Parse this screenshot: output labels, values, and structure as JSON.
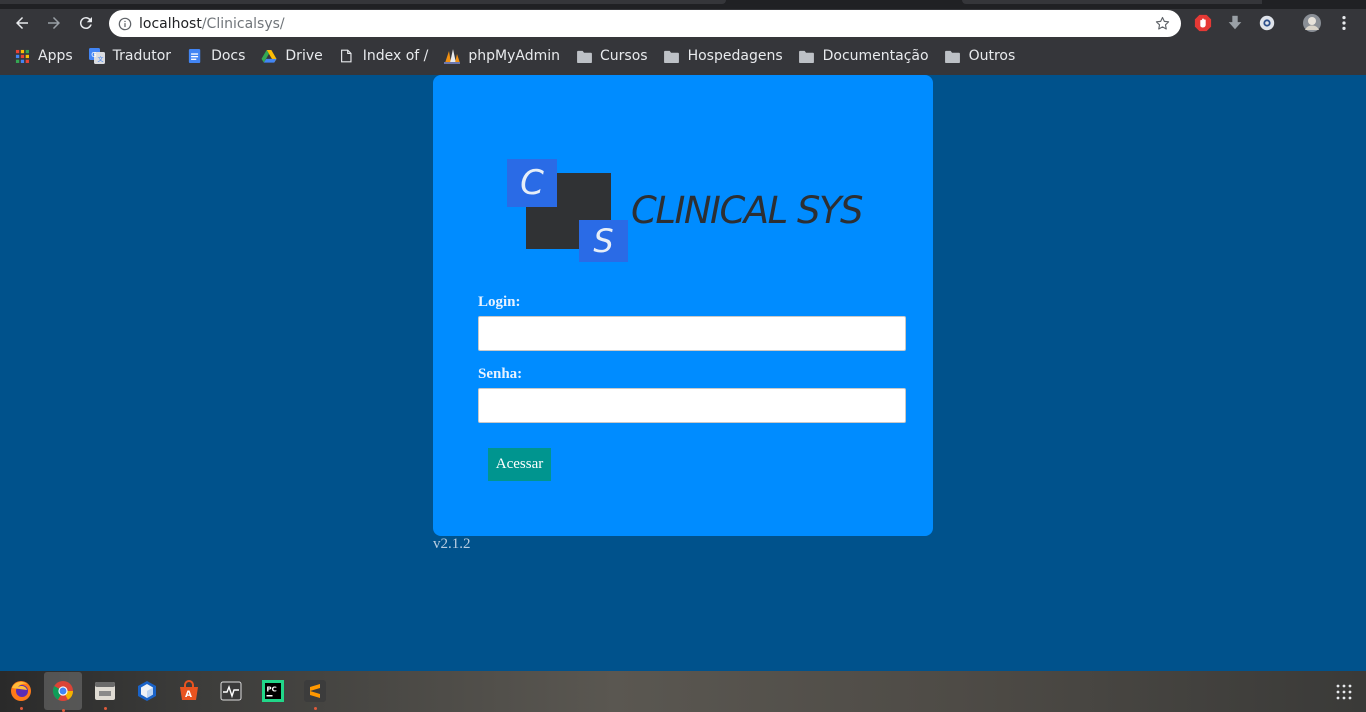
{
  "browser": {
    "url_host": "localhost",
    "url_path": "/Clinicalsys/"
  },
  "bookmarks": [
    {
      "label": "Apps",
      "icon": "apps-grid-icon"
    },
    {
      "label": "Tradutor",
      "icon": "google-translate-icon"
    },
    {
      "label": "Docs",
      "icon": "google-docs-icon"
    },
    {
      "label": "Drive",
      "icon": "google-drive-icon"
    },
    {
      "label": "Index of /",
      "icon": "page-icon"
    },
    {
      "label": "phpMyAdmin",
      "icon": "phpmyadmin-icon"
    },
    {
      "label": "Cursos",
      "icon": "folder-icon"
    },
    {
      "label": "Hospedagens",
      "icon": "folder-icon"
    },
    {
      "label": "Documentação",
      "icon": "folder-icon"
    },
    {
      "label": "Outros",
      "icon": "folder-icon"
    }
  ],
  "logo": {
    "letter_c": "C",
    "letter_s": "S",
    "brand": "CLINICAL SYS"
  },
  "login_form": {
    "login_label": "Login:",
    "login_value": "",
    "password_label": "Senha:",
    "password_value": "",
    "submit_label": "Acessar"
  },
  "version": "v2.1.2",
  "colors": {
    "page_background": "#00528c",
    "card_background": "#008cff",
    "logo_blue": "#2a6be6",
    "logo_dark": "#303234",
    "button": "#00958f"
  },
  "taskbar": [
    "firefox-icon",
    "chrome-icon",
    "files-icon",
    "virtualbox-icon",
    "software-center-icon",
    "system-monitor-icon",
    "pycharm-icon",
    "sublime-text-icon"
  ]
}
